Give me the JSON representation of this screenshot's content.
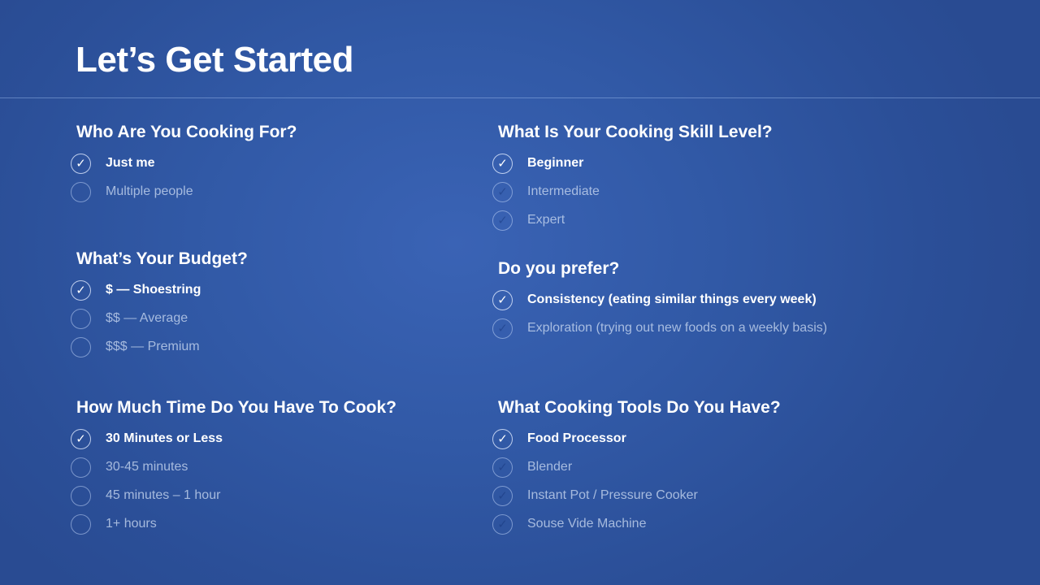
{
  "page": {
    "title": "Let’s Get Started"
  },
  "sections": [
    {
      "id": "sec-who",
      "name": "who-cooking-for",
      "title": "Who Are You Cooking For?",
      "ghost_checks": false,
      "options": [
        {
          "label": "Just me",
          "selected": true
        },
        {
          "label": "Multiple people",
          "selected": false
        }
      ]
    },
    {
      "id": "sec-budget",
      "name": "budget",
      "title": "What’s Your Budget?",
      "ghost_checks": false,
      "options": [
        {
          "label": "$ — Shoestring",
          "selected": true
        },
        {
          "label": "$$ — Average",
          "selected": false
        },
        {
          "label": "$$$ — Premium",
          "selected": false
        }
      ]
    },
    {
      "id": "sec-time",
      "name": "cooking-time",
      "title": "How Much Time Do You Have To Cook?",
      "ghost_checks": false,
      "options": [
        {
          "label": "30 Minutes or Less",
          "selected": true
        },
        {
          "label": "30-45 minutes",
          "selected": false
        },
        {
          "label": "45 minutes – 1 hour",
          "selected": false
        },
        {
          "label": "1+ hours",
          "selected": false
        }
      ]
    },
    {
      "id": "sec-skill",
      "name": "skill-level",
      "title": "What Is Your Cooking Skill Level?",
      "ghost_checks": true,
      "options": [
        {
          "label": "Beginner",
          "selected": true
        },
        {
          "label": "Intermediate",
          "selected": false
        },
        {
          "label": "Expert",
          "selected": false
        }
      ]
    },
    {
      "id": "sec-prefer",
      "name": "preference",
      "title": "Do you prefer?",
      "ghost_checks": true,
      "options": [
        {
          "label": "Consistency (eating similar things every week)",
          "selected": true
        },
        {
          "label": "Exploration (trying out new foods on a weekly basis)",
          "selected": false
        }
      ]
    },
    {
      "id": "sec-tools",
      "name": "cooking-tools",
      "title": "What Cooking Tools Do You Have?",
      "ghost_checks": true,
      "options": [
        {
          "label": "Food Processor",
          "selected": true
        },
        {
          "label": "Blender",
          "selected": false
        },
        {
          "label": "Instant Pot / Pressure Cooker",
          "selected": false
        },
        {
          "label": "Souse Vide Machine",
          "selected": false
        }
      ]
    }
  ],
  "icons": {
    "check": "check-icon",
    "check_glyph": "✓"
  },
  "colors": {
    "background": "#3159a6",
    "selected_text": "#ffffff",
    "unselected_text": "#c8d7f0"
  }
}
